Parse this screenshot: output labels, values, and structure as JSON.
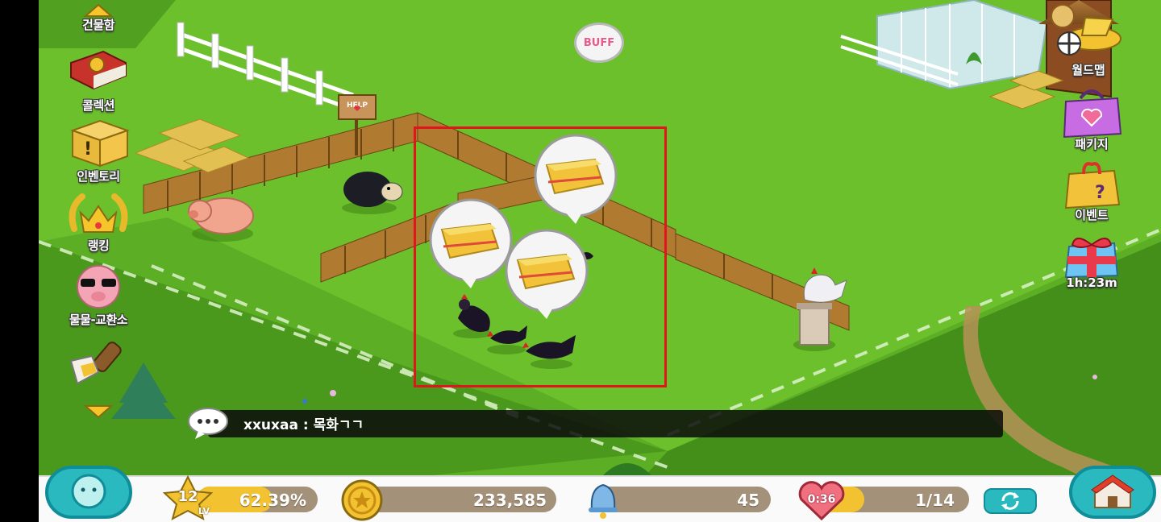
{
  "left_menu": {
    "top_label": "건물함",
    "items": [
      {
        "label": "콜렉션",
        "icon": "book-icon"
      },
      {
        "label": "인벤토리",
        "icon": "box-icon"
      },
      {
        "label": "랭킹",
        "icon": "crown-icon"
      },
      {
        "label": "물물-교환소",
        "icon": "pig-character-icon"
      },
      {
        "label": "",
        "icon": "paintbrush-icon"
      }
    ]
  },
  "right_menu": {
    "items": [
      {
        "label": "월드맵",
        "icon": "airplane-icon"
      },
      {
        "label": "패키지",
        "icon": "shopping-bag-icon"
      },
      {
        "label": "이벤트",
        "icon": "gift-box-icon"
      },
      {
        "label": "1h:23m",
        "icon": "present-icon"
      }
    ]
  },
  "buff_label": "BUFF",
  "scene": {
    "sign_text": "HELP"
  },
  "chat": {
    "message": "xxuxaa : 목화ㄱㄱ"
  },
  "hud": {
    "level": "12",
    "level_suffix": "LV",
    "exp_percent": "62.39%",
    "exp_fraction": 0.6239,
    "gold": "233,585",
    "bells": "45",
    "hearts_timer": "0:36",
    "hearts": "1/14"
  },
  "colors": {
    "grass": "#6cc02c",
    "highlight_box": "#e0161c",
    "accent_teal": "#2bb9c0",
    "pill_brown": "#a4917a"
  }
}
